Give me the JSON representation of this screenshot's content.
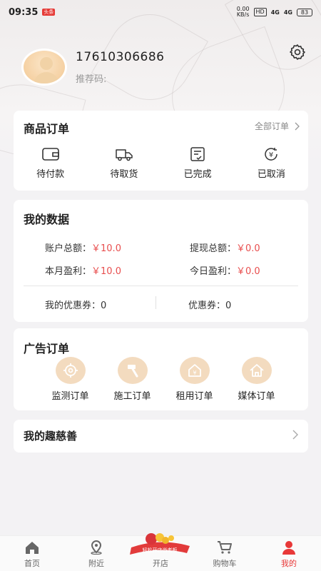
{
  "status_bar": {
    "time": "09:35",
    "notif_badge": "头条",
    "net_speed_top": "0.00",
    "net_speed_unit": "KB/s",
    "hd_chip": "HD",
    "signal1": "4G",
    "signal2": "4G",
    "battery": "83"
  },
  "profile": {
    "phone": "17610306686",
    "referral_label": "推荐码:"
  },
  "orders": {
    "title": "商品订单",
    "all_label": "全部订单",
    "items": [
      {
        "label": "待付款",
        "icon": "wallet-icon"
      },
      {
        "label": "待取货",
        "icon": "truck-icon"
      },
      {
        "label": "已完成",
        "icon": "checklist-icon"
      },
      {
        "label": "已取消",
        "icon": "yen-refresh-icon"
      }
    ]
  },
  "my_data": {
    "title": "我的数据",
    "account_total_label": "账户总额：",
    "account_total_value": "￥10.0",
    "withdraw_total_label": "提现总额：",
    "withdraw_total_value": "￥0.0",
    "month_profit_label": "本月盈利：",
    "month_profit_value": "￥10.0",
    "today_profit_label": "今日盈利：",
    "today_profit_value": "￥0.0",
    "my_coupons_label": "我的优惠券：",
    "my_coupons_value": "0",
    "coupons_label": "优惠券：",
    "coupons_value": "0"
  },
  "ads": {
    "title": "广告订单",
    "items": [
      {
        "label": "监测订单",
        "icon": "target-icon"
      },
      {
        "label": "施工订单",
        "icon": "hammer-icon"
      },
      {
        "label": "租用订单",
        "icon": "house-yen-icon"
      },
      {
        "label": "媒体订单",
        "icon": "home-icon"
      }
    ]
  },
  "charity": {
    "title": "我的趣慈善"
  },
  "tabbar": {
    "items": [
      {
        "label": "首页",
        "icon": "home-icon"
      },
      {
        "label": "附近",
        "icon": "location-pin-icon"
      },
      {
        "label": "开店",
        "icon": "shop-promo-icon"
      },
      {
        "label": "购物车",
        "icon": "cart-icon"
      },
      {
        "label": "我的",
        "icon": "user-icon"
      }
    ],
    "active_index": 4,
    "promo_text": "轻松开店当老板"
  },
  "colors": {
    "accent": "#e83838",
    "value_red": "#e84e4e",
    "icon_bg": "#f3dbbf"
  }
}
